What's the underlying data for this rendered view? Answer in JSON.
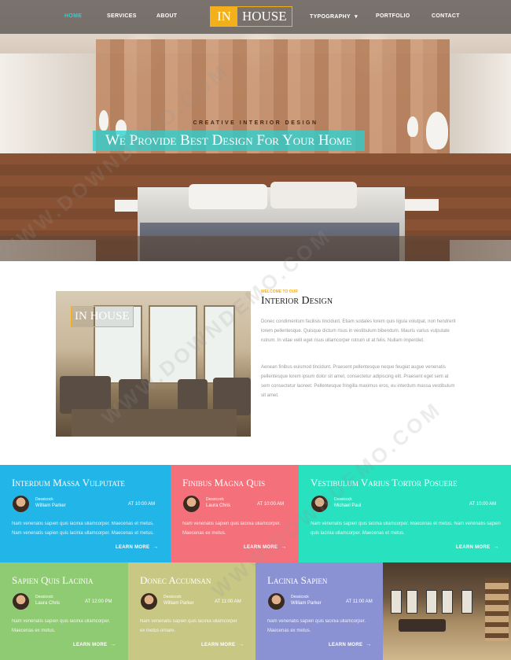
{
  "nav": {
    "items": [
      "HOME",
      "SERVICES",
      "ABOUT",
      "TYPOGRAPHY",
      "PORTFOLIO",
      "CONTACT"
    ],
    "dropdown_caret": "▾",
    "logo_in": "IN",
    "logo_house": "HOUSE",
    "active_color": "#2bd0d0"
  },
  "hero": {
    "subtitle": "CREATIVE INTERIOR DESIGN",
    "title": "We Provide Best Design For Your Home"
  },
  "about": {
    "image_logo": "IN HOUSE",
    "tag": "WELCOME TO OUR",
    "title": "Interior Design",
    "paragraph1": "Donec condimentum facilisis tincidunt. Etiam sodales lorem quis ligula volutpat, non hendrerit lorem pellentesque. Quisque dictum risus in vestibulum bibendum. Mauris varius vulputate rutrum. In vitae velit eget risus ullamcorper rutrum ut at felis. Nullam imperdiet.",
    "paragraph2": "Aenean finibus euismod tincidunt. Praesent pellentesque neque feugiat augue venenatis pellentesque lorem ipsum dolor sit amet, consectetur adipiscing elit. Praesent eget sem at sem consectetur laoreet. Pellentesque fringilla maximus eros, eu interdum massa vestibulum sit amet."
  },
  "cards": [
    {
      "title": "Interdum Massa Vulputate",
      "meta1": "Dessicock",
      "author": "William Parker",
      "time": "AT 10:00 AM",
      "text": "Nam venenatis sapien quis lacinia ullamcorper. Maecenas et metus. Nam venenatis sapien quis lacinia ullamcorper. Maecenas et metus.",
      "more": "LEARN MORE",
      "color": "#22b5e8"
    },
    {
      "title": "Finibus Magna Quis",
      "meta1": "Dessicock",
      "author": "Laura Chris",
      "time": "AT 10:00 AM",
      "text": "Nam venenatis sapien quis lacinia ullamcorper. Maecenas ex metus.",
      "more": "LEARN MORE",
      "color": "#f4707a"
    },
    {
      "title": "Vestibulum Varius Tortor Posuere",
      "meta1": "Dessicock",
      "author": "Michael Paul",
      "time": "AT 10:00 AM",
      "text": "Nam venenatis sapien quis lacinia ullamcorper. Maecenas et metus. Nam venenatis sapien quis lacinia ullamcorper. Maecenas et metus.",
      "more": "LEARN MORE",
      "color": "#27e1bf"
    },
    {
      "title": "Sapien Quis Lacinia",
      "meta1": "Dessicock",
      "author": "Laura Chris",
      "time": "AT 12:00 PM",
      "text": "Nam venenatis sapien quis lacinia ullamcorper. Maecenas ex metus.",
      "more": "LEARN MORE",
      "color": "#8fcb73"
    },
    {
      "title": "Donec Accumsan",
      "meta1": "Dessicock",
      "author": "William Parker",
      "time": "AT 11:00 AM",
      "text": "Nam venenatis sapien quis lacinia ullamcorper ex metus ornare.",
      "more": "LEARN MORE",
      "color": "#c9c784"
    },
    {
      "title": "Lacinia Sapien",
      "meta1": "Dessicock",
      "author": "William Parker",
      "time": "AT 11:00 AM",
      "text": "Nam venenatis sapien quis lacinia ullamcorper. Maecenas ex metus.",
      "more": "LEARN MORE",
      "color": "#8b92d4"
    }
  ],
  "arrow": "→",
  "watermark": "WWW.DOWNDEMO.COM"
}
